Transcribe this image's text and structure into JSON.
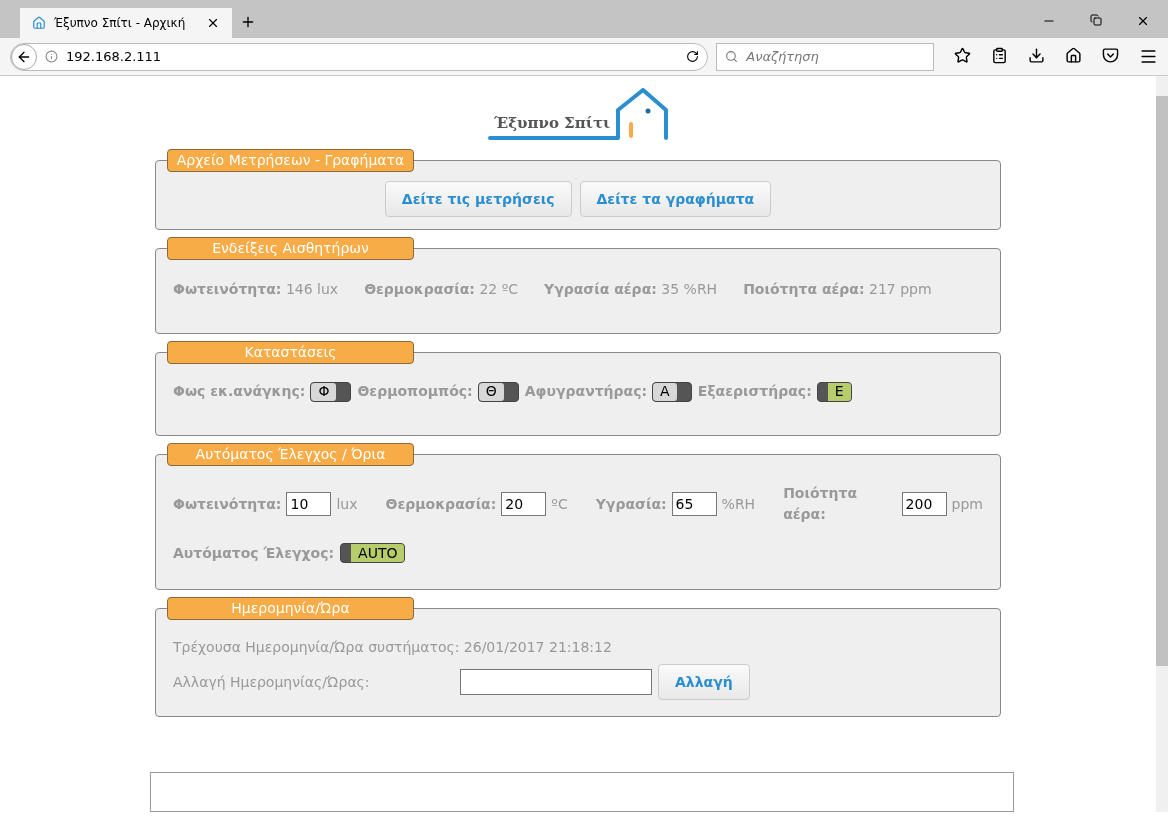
{
  "browser": {
    "tab_title": "Έξυπνο Σπίτι - Αρχική",
    "url": "192.168.2.111",
    "search_placeholder": "Αναζήτηση"
  },
  "logo": {
    "text": "Έξυπνο Σπίτι"
  },
  "archive": {
    "legend": "Αρχείο Μετρήσεων - Γραφήματα",
    "buttons": [
      "Δείτε τις μετρήσεις",
      "Δείτε τα γραφήματα"
    ]
  },
  "sensors": {
    "legend": "Ενδείξεις Αισθητήρων",
    "readings": [
      {
        "label": "Φωτεινότητα:",
        "value": "146 lux"
      },
      {
        "label": "Θερμοκρασία:",
        "value": "22 ºC"
      },
      {
        "label": "Υγρασία αέρα:",
        "value": "35 %RH"
      },
      {
        "label": "Ποιότητα αέρα:",
        "value": "217 ppm"
      }
    ]
  },
  "states": {
    "legend": "Καταστάσεις",
    "devices": [
      {
        "label": "Φως εκ.ανάγκης:",
        "letter": "Φ",
        "on": false
      },
      {
        "label": "Θερμοπομπός:",
        "letter": "Θ",
        "on": false
      },
      {
        "label": "Αφυγραντήρας:",
        "letter": "Α",
        "on": false
      },
      {
        "label": "Εξαεριστήρας:",
        "letter": "Ε",
        "on": true
      }
    ]
  },
  "auto": {
    "legend": "Αυτόματος Έλεγχος / Όρια",
    "limits": [
      {
        "label": "Φωτεινότητα:",
        "value": "10",
        "unit": "lux"
      },
      {
        "label": "Θερμοκρασία:",
        "value": "20",
        "unit": "ºC"
      },
      {
        "label": "Υγρασία:",
        "value": "65",
        "unit": "%RH"
      },
      {
        "label": "Ποιότητα αέρα:",
        "value": "200",
        "unit": "ppm"
      }
    ],
    "auto_label": "Αυτόματος Έλεγχος:",
    "auto_toggle": {
      "text": "AUTO",
      "on": true
    }
  },
  "datetime": {
    "legend": "Ημερομηνία/Ώρα",
    "current": "Τρέχουσα Ημερομηνία/Ώρα συστήματος: 26/01/2017 21:18:12",
    "change_label": "Αλλαγή Ημερομηνίας/Ώρας:",
    "button": "Αλλαγή"
  }
}
